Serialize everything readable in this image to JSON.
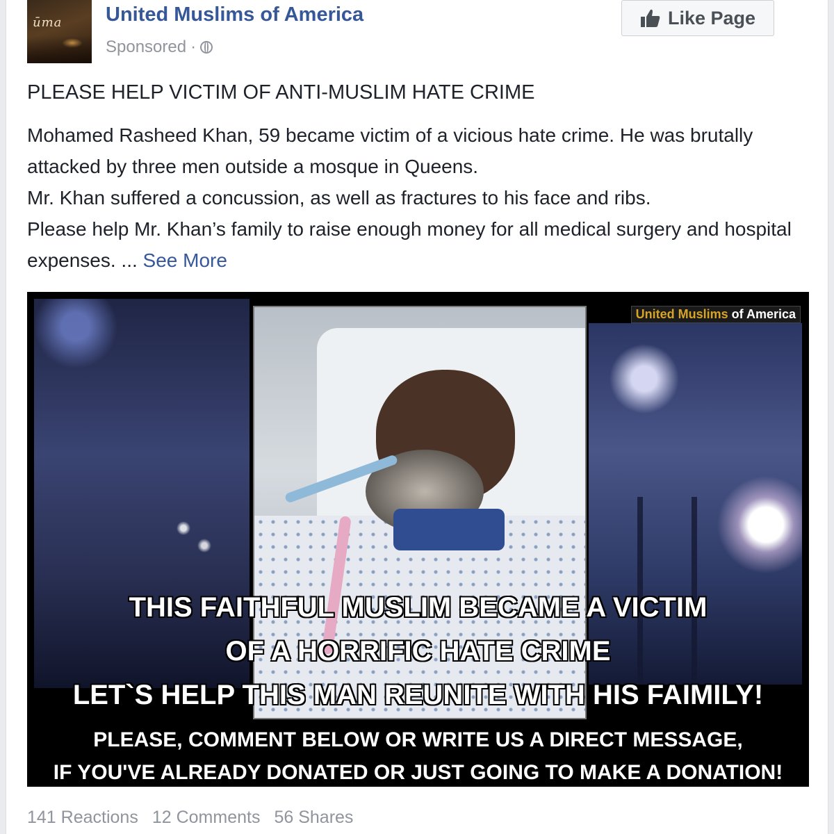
{
  "post": {
    "page_name": "United Muslims of America",
    "sponsored": "Sponsored",
    "separator": "·",
    "privacy_icon": "globe-icon",
    "like_button": "Like Page",
    "like_icon": "thumbs-up-icon",
    "headline": "PLEASE HELP VICTIM OF ANTI-MUSLIM HATE CRIME",
    "body": {
      "p1": "Mohamed Rasheed Khan, 59 became victim of a vicious hate crime. He was brutally attacked by three men outside a mosque in Queens.",
      "p2": "Mr. Khan suffered a concussion, as well as fractures to his face and ribs.",
      "p3": "Please help Mr. Khan’s family to raise enough money for all medical surgery and hospital expenses. ...",
      "see_more": "See More"
    },
    "image": {
      "watermark_part1": "United Muslims",
      "watermark_part2": " of America",
      "line1": "THIS FAITHFUL MUSLIM BECAME A VICTIM",
      "line2": "OF A HORRIFIC HATE CRIME",
      "line3": "LET`S HELP THIS MAN REUNITE WITH HIS FAIMILY!",
      "line4": "PLEASE, COMMENT BELOW OR WRITE US A DIRECT MESSAGE,",
      "line5": "IF YOU'VE ALREADY DONATED OR JUST GOING TO MAKE A DONATION!"
    },
    "stats": {
      "reactions": "141 Reactions",
      "comments": "12 Comments",
      "shares": "56 Shares"
    }
  },
  "colors": {
    "link_blue": "#365899",
    "meta_gray": "#90949c",
    "text": "#1d2129",
    "watermark_gold": "#d8a426"
  }
}
